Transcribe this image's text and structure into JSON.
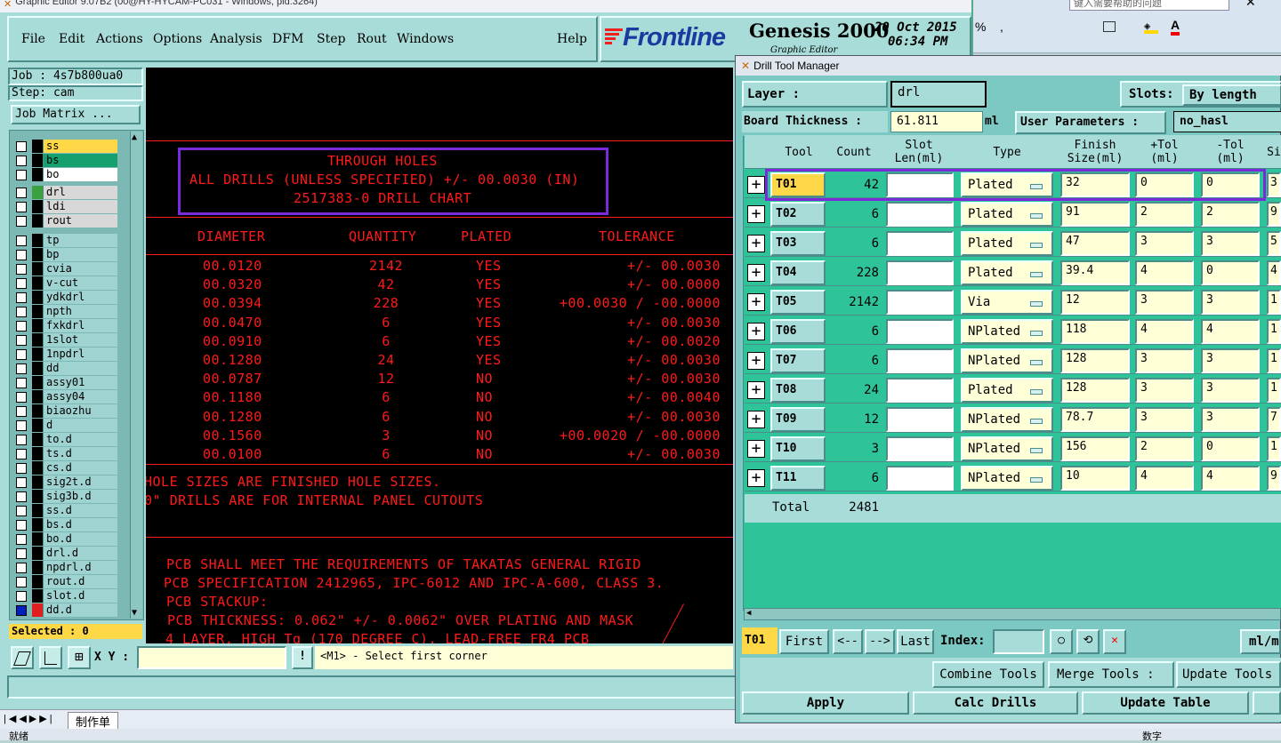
{
  "window": {
    "title": "Graphic Editor 9.07B2 (00@HY-HYCAM-PC031 - Windows, pid:3264)"
  },
  "menu": [
    "File",
    "Edit",
    "Actions",
    "Options",
    "Analysis",
    "DFM",
    "Step",
    "Rout",
    "Windows"
  ],
  "help": "Help",
  "brand": {
    "logo": "Frontline",
    "product": "Genesis 2000",
    "date": "20 Oct 2015",
    "time": "06:34 PM",
    "sub": "Graphic Editor"
  },
  "excel": {
    "search_placeholder": "键入需要帮助的问题",
    "pct": "%",
    "comma": ","
  },
  "job": {
    "job": "Job : 4s7b800ua0",
    "step": "Step: cam",
    "matrix_btn": "Job Matrix ..."
  },
  "layers": [
    "ss",
    "bs",
    "bo",
    "drl",
    "ldi",
    "rout",
    "tp",
    "bp",
    "cvia",
    "v-cut",
    "ydkdrl",
    "npth",
    "fxkdrl",
    "1slot",
    "1npdrl",
    "dd",
    "assy01",
    "assy04",
    "biaozhu",
    "d",
    "to.d",
    "ts.d",
    "cs.d",
    "sig2t.d",
    "sig3b.d",
    "ss.d",
    "bs.d",
    "bo.d",
    "drl.d",
    "npdrl.d",
    "rout.d",
    "slot.d",
    "dd.d"
  ],
  "selected": "Selected : 0",
  "status_bar": {
    "xy_label": "X Y :",
    "message": "<M1> - Select first corner"
  },
  "drawing": {
    "header": [
      "THROUGH HOLES",
      "ALL DRILLS (UNLESS SPECIFIED) +/- 00.0030 (IN)",
      "2517383-0 DRILL CHART"
    ],
    "columns": [
      "DIAMETER",
      "QUANTITY",
      "PLATED",
      "TOLERANCE"
    ],
    "rows": [
      [
        "00.0120",
        "2142",
        "YES",
        "+/- 00.0030"
      ],
      [
        "00.0320",
        "42",
        "YES",
        "+/- 00.0000"
      ],
      [
        "00.0394",
        "228",
        "YES",
        "+00.0030 / -00.0000"
      ],
      [
        "00.0470",
        "6",
        "YES",
        "+/- 00.0030"
      ],
      [
        "00.0910",
        "6",
        "YES",
        "+/- 00.0020"
      ],
      [
        "00.1280",
        "24",
        "YES",
        "+/- 00.0030"
      ],
      [
        "00.0787",
        "12",
        "NO",
        "+/- 00.0030"
      ],
      [
        "00.1180",
        "6",
        "NO",
        "+/- 00.0040"
      ],
      [
        "00.1280",
        "6",
        "NO",
        "+/- 00.0030"
      ],
      [
        "00.1560",
        "3",
        "NO",
        "+00.0020 / -00.0000"
      ],
      [
        "00.0100",
        "6",
        "NO",
        "+/- 00.0030"
      ]
    ],
    "notes1": [
      "HOLE SIZES ARE FINISHED HOLE SIZES.",
      "0\" DRILLS ARE FOR INTERNAL PANEL CUTOUTS"
    ],
    "notes2": [
      "PCB SHALL MEET THE REQUIREMENTS OF TAKATAS GENERAL RIGID",
      "PCB SPECIFICATION 2412965, IPC-6012 AND IPC-A-600, CLASS 3.",
      "PCB STACKUP:",
      "PCB THICKNESS: 0.062\" +/- 0.0062\" OVER PLATING AND MASK",
      "4 LAYER, HIGH Tg (170 DEGREE C), LEAD-FREE FR4 PCB"
    ]
  },
  "dtm": {
    "title": "Drill Tool Manager",
    "layer_label": "Layer :",
    "layer_value": "drl",
    "slots_label": "Slots:",
    "slots_value": "By length",
    "thickness_label": "Board Thickness :",
    "thickness_value": "61.811",
    "thickness_unit": "ml",
    "user_params_label": "User Parameters :",
    "user_params_value": "no_hasl",
    "columns": [
      "Tool",
      "Count",
      "Slot Len(ml)",
      "Type",
      "Finish Size(ml)",
      "+Tol (ml)",
      "-Tol (ml)",
      "Si"
    ],
    "tools": [
      {
        "tool": "T01",
        "count": "42",
        "type": "Plated",
        "finish": "32",
        "ptol": "0",
        "ntol": "0",
        "si": "3"
      },
      {
        "tool": "T02",
        "count": "6",
        "type": "Plated",
        "finish": "91",
        "ptol": "2",
        "ntol": "2",
        "si": "9"
      },
      {
        "tool": "T03",
        "count": "6",
        "type": "Plated",
        "finish": "47",
        "ptol": "3",
        "ntol": "3",
        "si": "5"
      },
      {
        "tool": "T04",
        "count": "228",
        "type": "Plated",
        "finish": "39.4",
        "ptol": "4",
        "ntol": "0",
        "si": "4"
      },
      {
        "tool": "T05",
        "count": "2142",
        "type": "Via",
        "finish": "12",
        "ptol": "3",
        "ntol": "3",
        "si": "1"
      },
      {
        "tool": "T06",
        "count": "6",
        "type": "NPlated",
        "finish": "118",
        "ptol": "4",
        "ntol": "4",
        "si": "1"
      },
      {
        "tool": "T07",
        "count": "6",
        "type": "NPlated",
        "finish": "128",
        "ptol": "3",
        "ntol": "3",
        "si": "1"
      },
      {
        "tool": "T08",
        "count": "24",
        "type": "Plated",
        "finish": "128",
        "ptol": "3",
        "ntol": "3",
        "si": "1"
      },
      {
        "tool": "T09",
        "count": "12",
        "type": "NPlated",
        "finish": "78.7",
        "ptol": "3",
        "ntol": "3",
        "si": "7"
      },
      {
        "tool": "T10",
        "count": "3",
        "type": "NPlated",
        "finish": "156",
        "ptol": "2",
        "ntol": "0",
        "si": "1"
      },
      {
        "tool": "T11",
        "count": "6",
        "type": "NPlated",
        "finish": "10",
        "ptol": "4",
        "ntol": "4",
        "si": "9"
      }
    ],
    "total_label": "Total",
    "total_value": "2481",
    "current_tool": "T01",
    "nav": [
      "First",
      "<--",
      "-->",
      "Last"
    ],
    "index_label": "Index:",
    "units_btn": "ml/m",
    "row2": [
      "Combine Tools",
      "Merge Tools :",
      "Update Tools"
    ],
    "row3": [
      "Apply",
      "Calc Drills",
      "Update Table"
    ]
  },
  "excel_bottom": {
    "sheet_tab": "制作单",
    "status_left": "就绪",
    "status_right": "数字"
  }
}
